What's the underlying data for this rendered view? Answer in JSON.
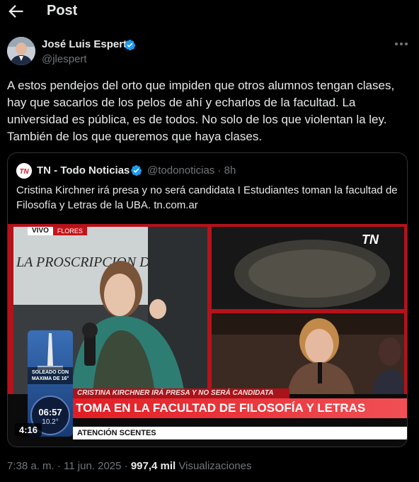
{
  "header": {
    "title": "Post",
    "back_icon": "arrow-left-icon"
  },
  "author": {
    "name": "José Luis Espert",
    "handle": "@jlespert",
    "verified_icon": "verified-badge-icon",
    "more_icon": "more-options-icon"
  },
  "tweet": {
    "text": "A estos pendejos del orto que impiden que otros alumnos tengan clases, hay que sacarlos de los pelos de ahí y echarlos de la facultad. La universidad es pública, es de todos. No solo de los que violentan la ley. También de los que queremos que haya clases."
  },
  "quote": {
    "name": "TN - Todo Noticias",
    "handle": "@todonoticias · 8h",
    "text": "Cristina Kirchner irá presa y no será candidata I Estudiantes toman la facultad de Filosofía y Letras de la UBA. tn.com.ar",
    "avatar_text": "TN",
    "media": {
      "live_label": "VIVO",
      "live_place": "FLORES",
      "channel_logo": "TN",
      "sign_text": "LA PROSCRIPCION DE CRIST",
      "weather_label": "SOLEADO CON MAXIMA DE 16°",
      "clock_day": "MA 11",
      "clock_time": "06:57",
      "clock_temp": "10.2°",
      "banner_small": "CRISTINA KIRCHNER IRÁ PRESA Y NO SERÁ CANDIDATA",
      "banner_big": "TOMA EN LA FACULTAD DE FILOSOFÍA Y LETRAS",
      "ticker": "ATENCIÓN  SCENTES",
      "duration": "4:16"
    }
  },
  "meta": {
    "time": "7:38 a. m. · 11 jun. 2025 · ",
    "views_count": "997,4 mil",
    "views_label": " Visualizaciones"
  },
  "colors": {
    "background": "#000000",
    "text": "#e7e9ea",
    "muted": "#71767b",
    "verified": "#1d9bf0",
    "border": "#2f3336"
  }
}
